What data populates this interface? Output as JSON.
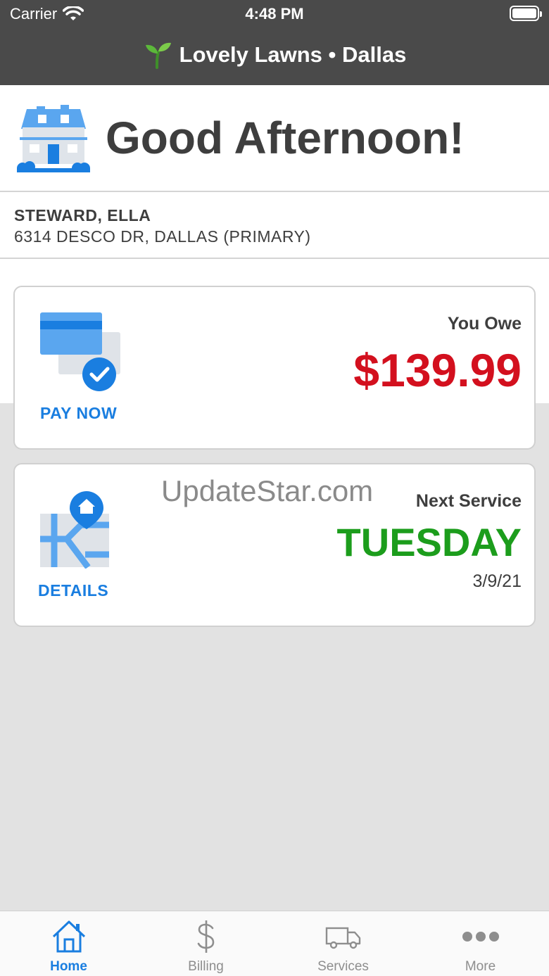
{
  "status_bar": {
    "carrier": "Carrier",
    "time": "4:48 PM"
  },
  "nav": {
    "title": "Lovely Lawns • Dallas",
    "logo_icon": "sprout-icon"
  },
  "greeting": "Good Afternoon!",
  "account": {
    "name": "STEWARD, ELLA",
    "address": "6314 DESCO DR, DALLAS (PRIMARY)"
  },
  "balance_card": {
    "action_label": "PAY NOW",
    "label": "You Owe",
    "amount": "$139.99",
    "icon": "credit-card-check-icon"
  },
  "service_card": {
    "action_label": "DETAILS",
    "watermark": "UpdateStar.com",
    "label": "Next Service",
    "day": "TUESDAY",
    "date": "3/9/21",
    "icon": "map-pin-icon"
  },
  "tabs": [
    {
      "label": "Home",
      "icon": "home-icon",
      "active": true
    },
    {
      "label": "Billing",
      "icon": "dollar-icon",
      "active": false
    },
    {
      "label": "Services",
      "icon": "truck-icon",
      "active": false
    },
    {
      "label": "More",
      "icon": "more-dots-icon",
      "active": false
    }
  ],
  "colors": {
    "header_bg": "#4a4a4a",
    "accent_blue": "#1a7ee0",
    "amount_red": "#d3101e",
    "service_green": "#1c9d1c",
    "page_bg": "#e2e2e2"
  }
}
